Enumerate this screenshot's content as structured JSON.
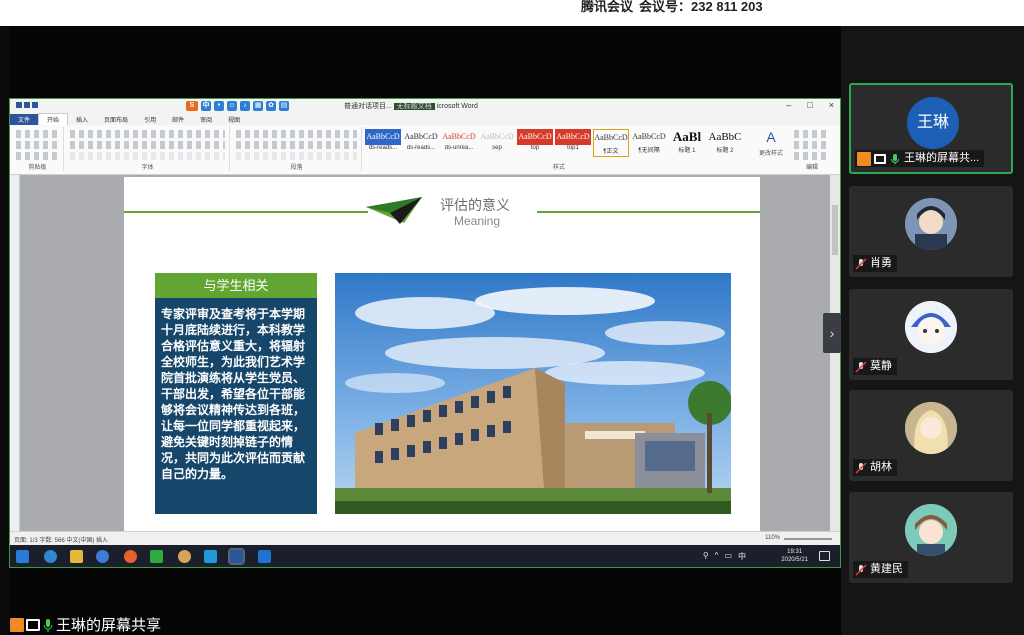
{
  "meeting": {
    "app": "腾讯会议",
    "meeting_id_label": "会议号：",
    "meeting_id": "232 811 203"
  },
  "word": {
    "title_left": "普通对话项目...",
    "title_badge": "无标题文档",
    "title_app": "icrosoft Word",
    "tabs": [
      "文件",
      "开始",
      "插入",
      "页面布局",
      "引用",
      "邮件",
      "审阅",
      "视图"
    ],
    "group_labels": [
      "剪贴板",
      "字体",
      "段落",
      "样式",
      "编辑"
    ],
    "styles": [
      {
        "sample": "AaBbCcD",
        "name": "ds-reads..."
      },
      {
        "sample": "AaBbCcD",
        "name": "ds-reads..."
      },
      {
        "sample": "AaBbCcD",
        "name": "ds-unrea..."
      },
      {
        "sample": "AaBbCcD",
        "name": "sep"
      },
      {
        "sample": "AaBbCcD",
        "name": "top"
      },
      {
        "sample": "AaBbCcD",
        "name": "top1"
      },
      {
        "sample": "AaBbCcD",
        "name": "¶正文"
      },
      {
        "sample": "AaBbCcD",
        "name": "¶无间隔"
      },
      {
        "sample": "AaBl",
        "name": "标题 1"
      },
      {
        "sample": "AaBbC",
        "name": "标题 2"
      }
    ],
    "change_styles": "更改样式",
    "status_left": "页面: 1/3  字数: 566  中文(中国)  插入",
    "zoom": "110%"
  },
  "slide": {
    "title": "评估的意义",
    "subtitle": "Meaning",
    "panel_title": "与学生相关",
    "panel_text": "专家评审及查考将于本学期十月底陆续进行，本科教学合格评估意义重大，将辐射全校师生，为此我们艺术学院首批演练将从学生党员、干部出发，希望各位干部能够将会议精神传达到各班，让每一位同学都重视起来，避免关键时刻掉链子的情况，共同为此次评估而贡献自己的力量。"
  },
  "taskbar": {
    "ime": "中",
    "time": "19:31",
    "date": "2020/5/21"
  },
  "participants": [
    {
      "name": "王琳的屏幕共...",
      "avatar_text": "王琳",
      "active": true
    },
    {
      "name": "肖勇",
      "active": false
    },
    {
      "name": "莫静",
      "active": false
    },
    {
      "name": "胡林",
      "active": false
    },
    {
      "name": "黄建民",
      "active": false
    }
  ],
  "share_label": "王琳的屏幕共享",
  "colors": {
    "accent_green": "#63a533",
    "panel_blue": "#16466a",
    "meeting_blue": "#1c5fb5",
    "active_border": "#2fa84f"
  }
}
